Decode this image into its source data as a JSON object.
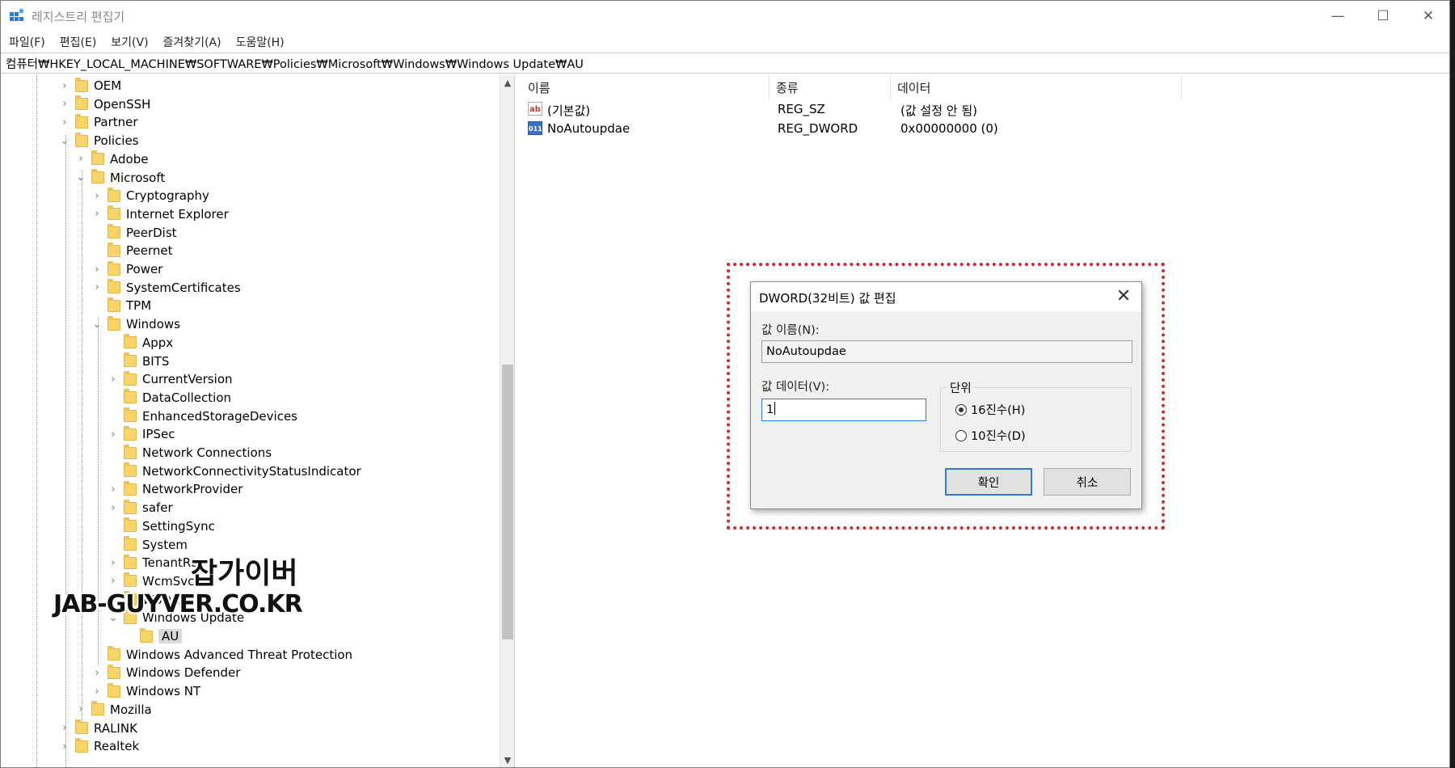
{
  "window": {
    "title": "레지스트리 편집기",
    "minimize": "—",
    "maximize": "☐",
    "close": "✕"
  },
  "menu": [
    "파일(F)",
    "편집(E)",
    "보기(V)",
    "즐겨찾기(A)",
    "도움말(H)"
  ],
  "address": "컴퓨터₩HKEY_LOCAL_MACHINE₩SOFTWARE₩Policies₩Microsoft₩Windows₩Windows Update₩AU",
  "tree": [
    {
      "label": "OEM",
      "exp": "›"
    },
    {
      "label": "OpenSSH",
      "exp": "›"
    },
    {
      "label": "Partner",
      "exp": "›"
    },
    {
      "label": "Policies",
      "exp": "⌄"
    },
    {
      "label": "Adobe",
      "exp": "›"
    },
    {
      "label": "Microsoft",
      "exp": "⌄"
    },
    {
      "label": "Cryptography",
      "exp": "›"
    },
    {
      "label": "Internet Explorer",
      "exp": "›"
    },
    {
      "label": "PeerDist",
      "exp": ""
    },
    {
      "label": "Peernet",
      "exp": ""
    },
    {
      "label": "Power",
      "exp": "›"
    },
    {
      "label": "SystemCertificates",
      "exp": "›"
    },
    {
      "label": "TPM",
      "exp": ""
    },
    {
      "label": "Windows",
      "exp": "⌄"
    },
    {
      "label": "Appx",
      "exp": ""
    },
    {
      "label": "BITS",
      "exp": ""
    },
    {
      "label": "CurrentVersion",
      "exp": "›"
    },
    {
      "label": "DataCollection",
      "exp": ""
    },
    {
      "label": "EnhancedStorageDevices",
      "exp": ""
    },
    {
      "label": "IPSec",
      "exp": "›"
    },
    {
      "label": "Network Connections",
      "exp": ""
    },
    {
      "label": "NetworkConnectivityStatusIndicator",
      "exp": ""
    },
    {
      "label": "NetworkProvider",
      "exp": "›"
    },
    {
      "label": "safer",
      "exp": "›"
    },
    {
      "label": "SettingSync",
      "exp": ""
    },
    {
      "label": "System",
      "exp": ""
    },
    {
      "label": "TenantRe",
      "exp": "›"
    },
    {
      "label": "WcmSvc",
      "exp": "›"
    },
    {
      "label": "WSDAPI",
      "exp": "›"
    },
    {
      "label": "Windows Update",
      "exp": "⌄"
    },
    {
      "label": "AU",
      "exp": ""
    },
    {
      "label": "Windows Advanced Threat Protection",
      "exp": ""
    },
    {
      "label": "Windows Defender",
      "exp": "›"
    },
    {
      "label": "Windows NT",
      "exp": "›"
    },
    {
      "label": "Mozilla",
      "exp": "›"
    },
    {
      "label": "RALINK",
      "exp": "›"
    },
    {
      "label": "Realtek",
      "exp": "›"
    }
  ],
  "list": {
    "columns": [
      "이름",
      "종류",
      "데이터"
    ],
    "rows": [
      {
        "icon": "ab",
        "name": "(기본값)",
        "type": "REG_SZ",
        "data": "(값 설정 안 됨)"
      },
      {
        "icon": "011",
        "name": "NoAutoupdae",
        "type": "REG_DWORD",
        "data": "0x00000000 (0)"
      }
    ]
  },
  "dialog": {
    "title": "DWORD(32비트) 값 편집",
    "close": "✕",
    "name_label": "값 이름(N):",
    "name_value": "NoAutoupdae",
    "data_label": "값 데이터(V):",
    "data_value": "1",
    "base_label": "단위",
    "hex_label": "16진수(H)",
    "dec_label": "10진수(D)",
    "ok": "확인",
    "cancel": "취소"
  },
  "watermark": {
    "line1": "잡가이버",
    "line2": "JAB-GUYVER.CO.KR"
  }
}
